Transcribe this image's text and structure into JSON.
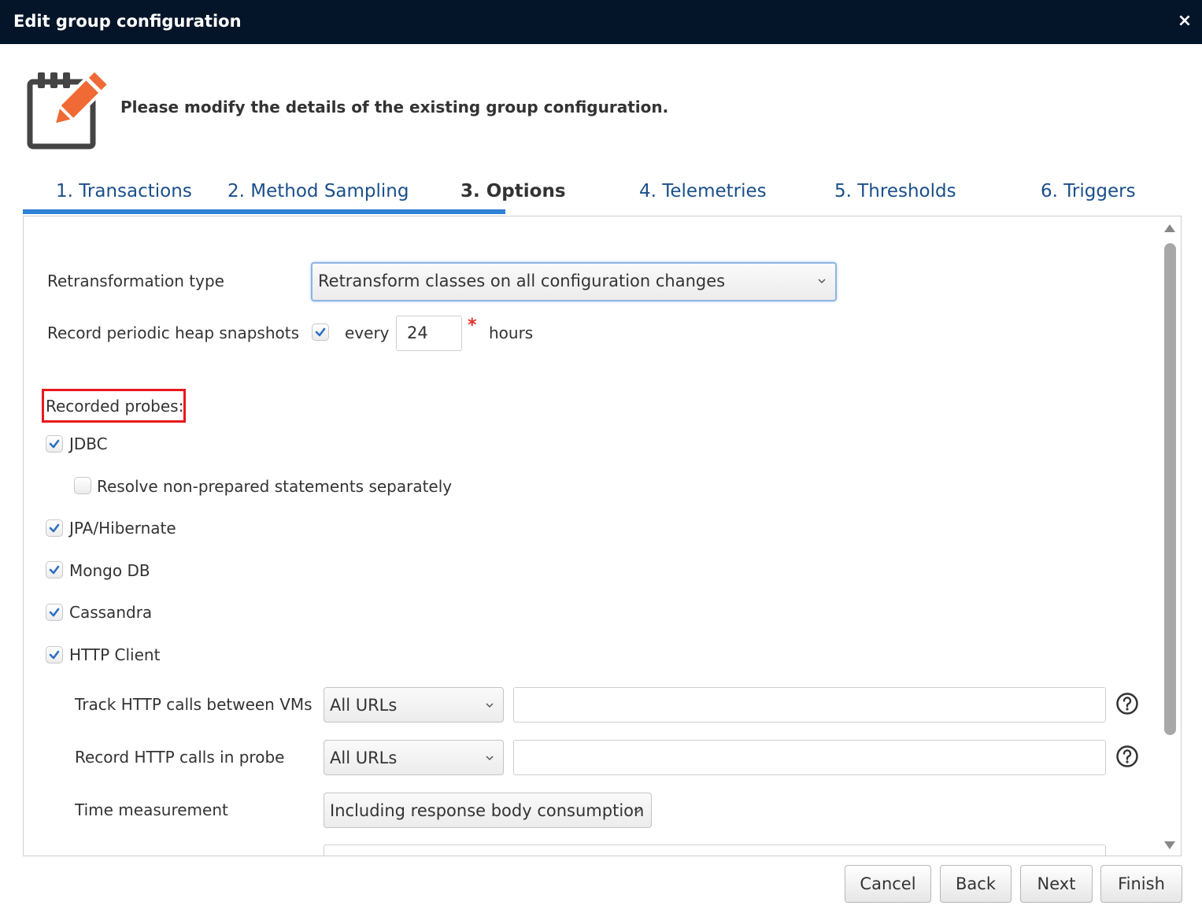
{
  "dialog": {
    "title": "Edit group configuration",
    "close_label": "×",
    "header_text": "Please modify the details of the existing group configuration."
  },
  "tabs": [
    {
      "label": "1. Transactions"
    },
    {
      "label": "2. Method Sampling"
    },
    {
      "label": "3. Options",
      "active": true
    },
    {
      "label": "4. Telemetries"
    },
    {
      "label": "5. Thresholds"
    },
    {
      "label": "6. Triggers"
    }
  ],
  "options": {
    "retransformation_label": "Retransformation type",
    "retransformation_value": "Retransform classes on all configuration changes",
    "heap_label": "Record periodic heap snapshots",
    "heap_checked": true,
    "every_label": "every",
    "heap_interval": "24",
    "required_mark": "*",
    "hours_label": "hours",
    "probes_label": "Recorded probes:",
    "probes": {
      "jdbc": {
        "label": "JDBC",
        "checked": true
      },
      "jdbc_resolve": {
        "label": "Resolve non-prepared statements separately",
        "checked": false
      },
      "jpa": {
        "label": "JPA/Hibernate",
        "checked": true
      },
      "mongo": {
        "label": "Mongo DB",
        "checked": true
      },
      "cassandra": {
        "label": "Cassandra",
        "checked": true
      },
      "http_client": {
        "label": "HTTP Client",
        "checked": true
      }
    },
    "http": {
      "track_label": "Track HTTP calls between VMs",
      "track_value": "All URLs",
      "track_input": "",
      "record_label": "Record HTTP calls in probe",
      "record_value": "All URLs",
      "record_input": "",
      "time_label": "Time measurement",
      "time_value": "Including response body consumption"
    }
  },
  "buttons": {
    "cancel": "Cancel",
    "back": "Back",
    "next": "Next",
    "finish": "Finish"
  },
  "colors": {
    "titlebar": "#041529",
    "accent": "#2f82d6",
    "tab_link": "#1a4f8a",
    "icon_orange": "#f06a35",
    "highlight": "#e8181c"
  }
}
